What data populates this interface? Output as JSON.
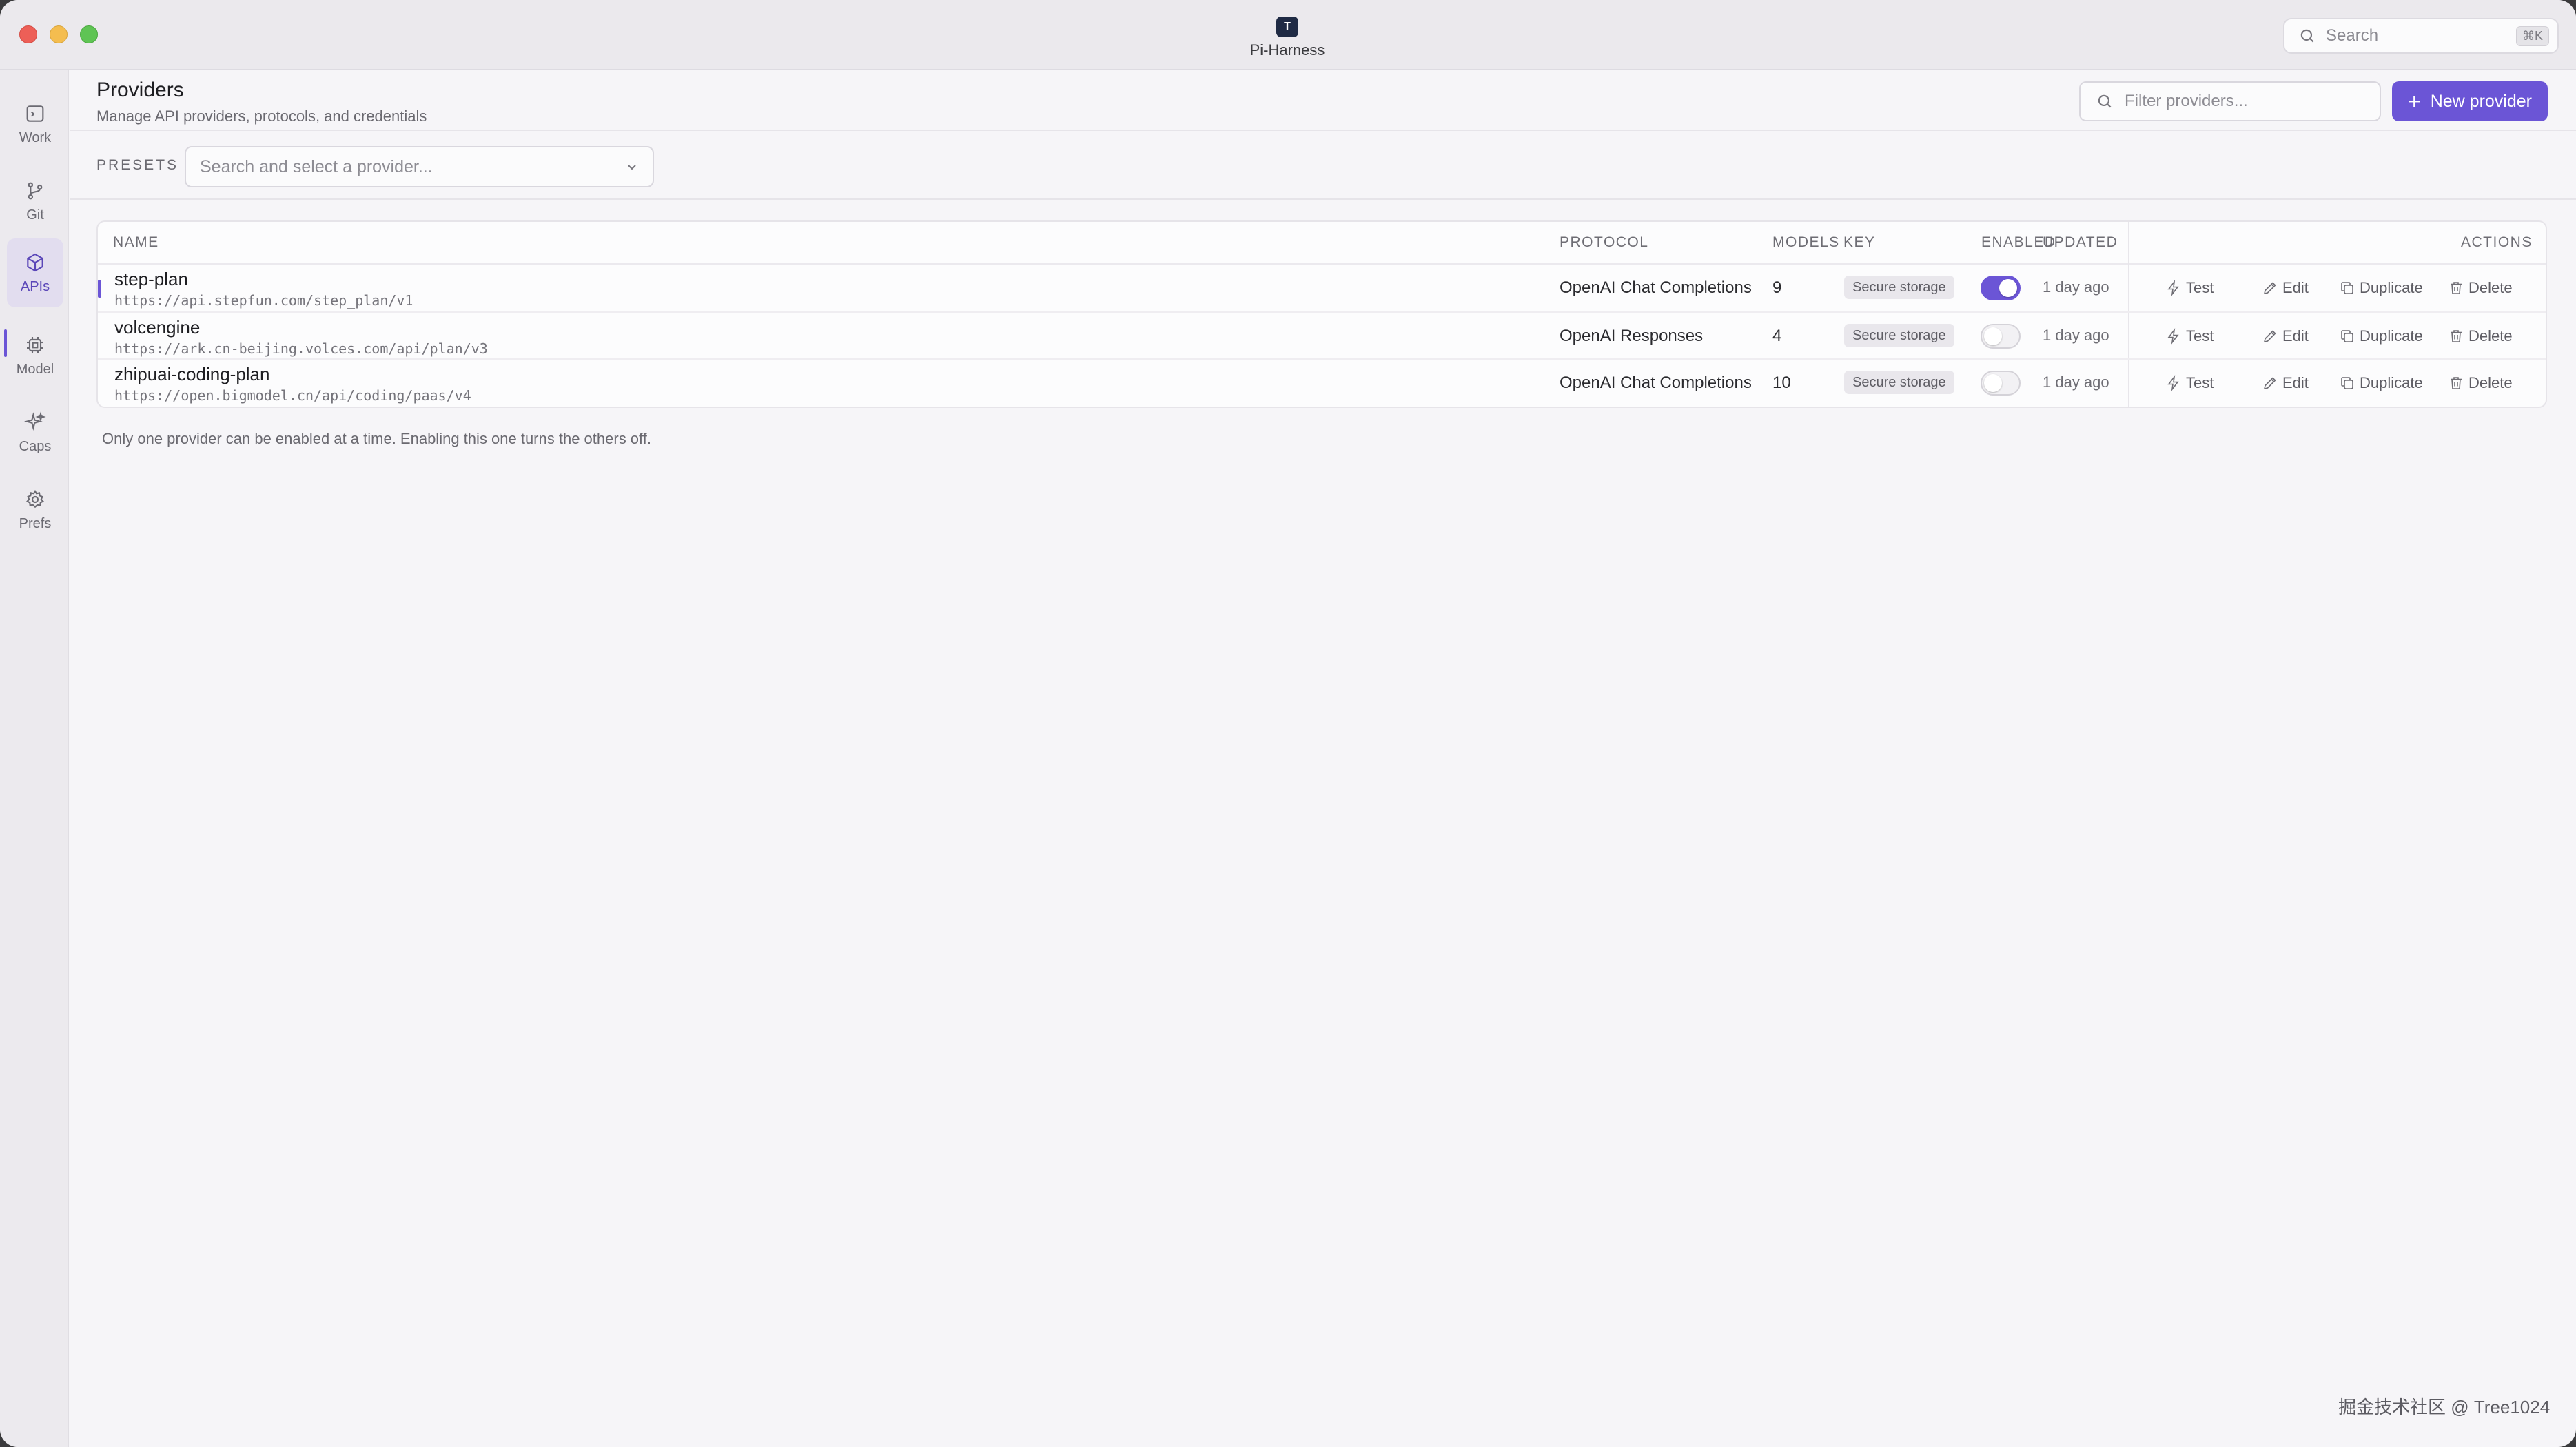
{
  "app": {
    "title": "Pi-Harness",
    "icon_text": "T"
  },
  "global_search": {
    "label": "Search",
    "shortcut": "⌘K"
  },
  "sidebar": {
    "items": [
      {
        "label": "Work",
        "icon": "terminal-icon"
      },
      {
        "label": "Git",
        "icon": "git-branch-icon"
      },
      {
        "label": "APIs",
        "icon": "cube-icon",
        "active": true
      },
      {
        "label": "Model",
        "icon": "chip-icon"
      },
      {
        "label": "Caps",
        "icon": "sparkles-icon"
      },
      {
        "label": "Prefs",
        "icon": "gear-icon"
      }
    ]
  },
  "header": {
    "title": "Providers",
    "subtitle": "Manage API providers, protocols, and credentials",
    "filter_placeholder": "Filter providers...",
    "new_button": "New provider"
  },
  "presets": {
    "label": "PRESETS",
    "placeholder": "Search and select a provider..."
  },
  "table": {
    "columns": {
      "name": "NAME",
      "protocol": "PROTOCOL",
      "models": "MODELS",
      "key": "KEY",
      "enabled": "ENABLED",
      "updated": "UPDATED",
      "actions": "ACTIONS"
    },
    "action_labels": {
      "test": "Test",
      "edit": "Edit",
      "duplicate": "Duplicate",
      "delete": "Delete"
    },
    "rows": [
      {
        "name": "step-plan",
        "url": "https://api.stepfun.com/step_plan/v1",
        "protocol": "OpenAI Chat Completions",
        "models": "9",
        "key": "Secure storage",
        "enabled": true,
        "updated": "1 day ago"
      },
      {
        "name": "volcengine",
        "url": "https://ark.cn-beijing.volces.com/api/plan/v3",
        "protocol": "OpenAI Responses",
        "models": "4",
        "key": "Secure storage",
        "enabled": false,
        "updated": "1 day ago"
      },
      {
        "name": "zhipuai-coding-plan",
        "url": "https://open.bigmodel.cn/api/coding/paas/v4",
        "protocol": "OpenAI Chat Completions",
        "models": "10",
        "key": "Secure storage",
        "enabled": false,
        "updated": "1 day ago"
      }
    ]
  },
  "footnote": "Only one provider can be enabled at a time. Enabling this one turns the others off.",
  "watermark": "掘金技术社区 @ Tree1024",
  "colors": {
    "accent": "#6b55d6",
    "sidebar_bg": "#eceaee",
    "content_bg": "#f6f5f8"
  }
}
